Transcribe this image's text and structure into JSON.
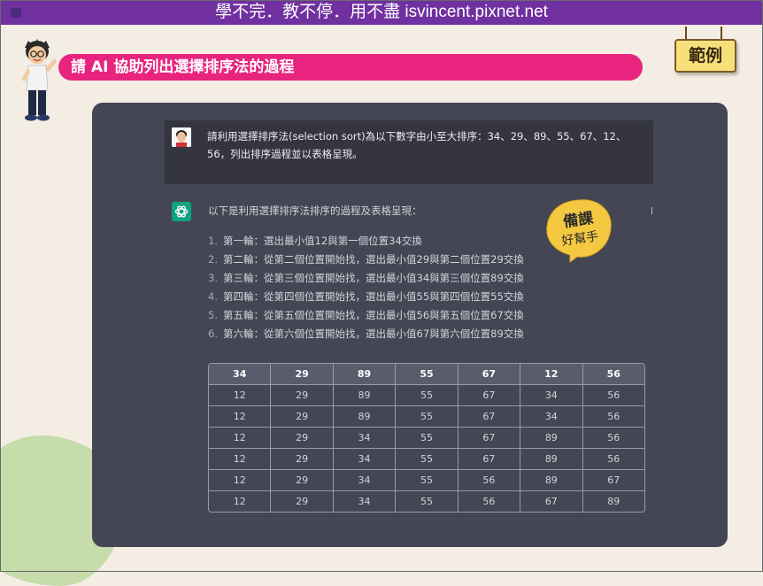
{
  "header": {
    "banner": "學不完．教不停．用不盡 isvincent.pixnet.net"
  },
  "slide": {
    "title": "請 AI 協助列出選擇排序法的過程",
    "example_tag": "範例",
    "sticker_line1": "備課",
    "sticker_line2": "好幫手"
  },
  "chat": {
    "user_message": "請利用選擇排序法(selection sort)為以下數字由小至大排序：34、29、89、55、67、12、56，列出排序過程並以表格呈現。",
    "assistant_intro": "以下是利用選擇排序法排序的過程及表格呈現：",
    "steps": [
      {
        "n": "1.",
        "text": "第一輪：選出最小值12與第一個位置34交換"
      },
      {
        "n": "2.",
        "text": "第二輪：從第二個位置開始找，選出最小值29與第二個位置29交換"
      },
      {
        "n": "3.",
        "text": "第三輪：從第三個位置開始找，選出最小值34與第三個位置89交換"
      },
      {
        "n": "4.",
        "text": "第四輪：從第四個位置開始找，選出最小值55與第四個位置55交換"
      },
      {
        "n": "5.",
        "text": "第五輪：從第五個位置開始找，選出最小值56與第五個位置67交換"
      },
      {
        "n": "6.",
        "text": "第六輪：從第六個位置開始找，選出最小值67與第六個位置89交換"
      }
    ],
    "table": {
      "headers": [
        "34",
        "29",
        "89",
        "55",
        "67",
        "12",
        "56"
      ],
      "rows": [
        [
          "12",
          "29",
          "89",
          "55",
          "67",
          "34",
          "56"
        ],
        [
          "12",
          "29",
          "89",
          "55",
          "67",
          "34",
          "56"
        ],
        [
          "12",
          "29",
          "34",
          "55",
          "67",
          "89",
          "56"
        ],
        [
          "12",
          "29",
          "34",
          "55",
          "67",
          "89",
          "56"
        ],
        [
          "12",
          "29",
          "34",
          "55",
          "56",
          "89",
          "67"
        ],
        [
          "12",
          "29",
          "34",
          "55",
          "56",
          "67",
          "89"
        ]
      ]
    }
  },
  "colors": {
    "banner": "#7030a0",
    "title_pill": "#e8247f",
    "chat_bg": "#444654",
    "user_bg": "#343541",
    "gpt_green": "#10a37f",
    "sticker_yellow": "#f5c842"
  }
}
